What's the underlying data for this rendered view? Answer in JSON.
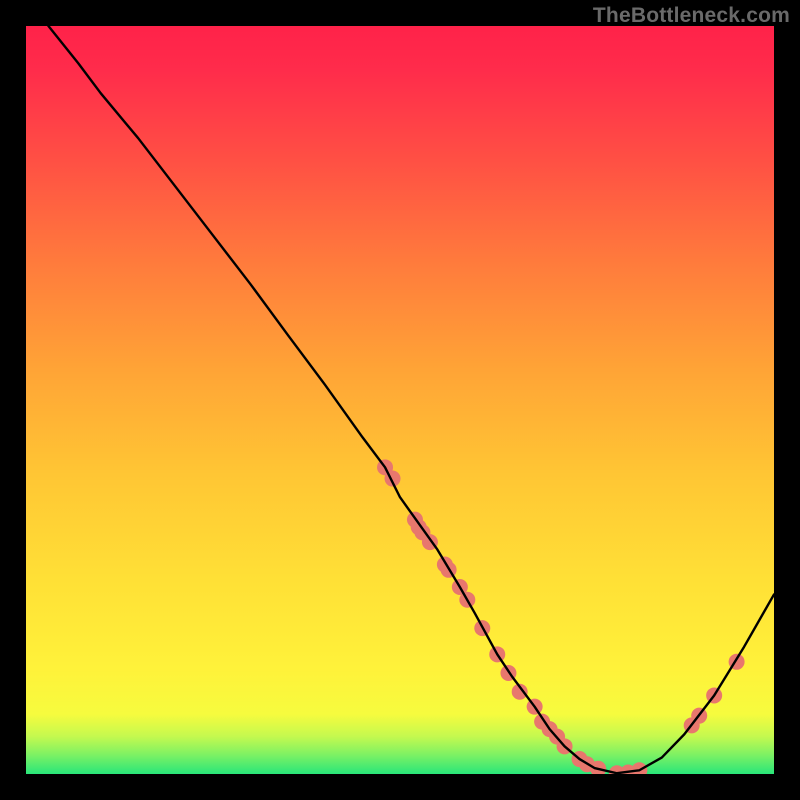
{
  "watermark": "TheBottleneck.com",
  "chart_data": {
    "type": "line",
    "title": "",
    "xlabel": "",
    "ylabel": "",
    "xlim": [
      0,
      100
    ],
    "ylim": [
      0,
      100
    ],
    "grid": false,
    "legend": "none",
    "main_curve": {
      "x": [
        3,
        7,
        10,
        15,
        20,
        25,
        30,
        35,
        40,
        45,
        48,
        50,
        55,
        58,
        60,
        63,
        65,
        68,
        70,
        72,
        74,
        76,
        79,
        82,
        85,
        88,
        92,
        96,
        100
      ],
      "y": [
        100,
        95,
        91,
        85,
        78.5,
        72,
        65.5,
        58.7,
        52,
        45,
        41,
        37,
        30,
        25,
        21.5,
        16,
        13,
        9,
        6,
        3.7,
        2,
        0.8,
        0.1,
        0.5,
        2.2,
        5.3,
        10.5,
        17,
        24
      ]
    },
    "markers": [
      {
        "x": 48,
        "y": 41
      },
      {
        "x": 49,
        "y": 39.5
      },
      {
        "x": 52,
        "y": 34
      },
      {
        "x": 52.5,
        "y": 33
      },
      {
        "x": 53,
        "y": 32.3
      },
      {
        "x": 54,
        "y": 31
      },
      {
        "x": 56,
        "y": 28
      },
      {
        "x": 56.5,
        "y": 27.3
      },
      {
        "x": 58,
        "y": 25
      },
      {
        "x": 59,
        "y": 23.3
      },
      {
        "x": 61,
        "y": 19.5
      },
      {
        "x": 63,
        "y": 16
      },
      {
        "x": 64.5,
        "y": 13.5
      },
      {
        "x": 66,
        "y": 11
      },
      {
        "x": 68,
        "y": 9
      },
      {
        "x": 69,
        "y": 7
      },
      {
        "x": 70,
        "y": 6
      },
      {
        "x": 71,
        "y": 5
      },
      {
        "x": 72,
        "y": 3.7
      },
      {
        "x": 74,
        "y": 2
      },
      {
        "x": 75,
        "y": 1.3
      },
      {
        "x": 76.5,
        "y": 0.7
      },
      {
        "x": 79,
        "y": 0.1
      },
      {
        "x": 80.5,
        "y": 0.2
      },
      {
        "x": 82,
        "y": 0.5
      },
      {
        "x": 89,
        "y": 6.5
      },
      {
        "x": 90,
        "y": 7.8
      },
      {
        "x": 92,
        "y": 10.5
      },
      {
        "x": 95,
        "y": 15
      }
    ],
    "marker_color": "#E8776D",
    "marker_radius": 8,
    "curve_color": "#000000",
    "background_gradient_top": "#FF2A4B",
    "background_gradient_mid": "#FFE23A",
    "background_gradient_bottom": "#2EE77A"
  }
}
